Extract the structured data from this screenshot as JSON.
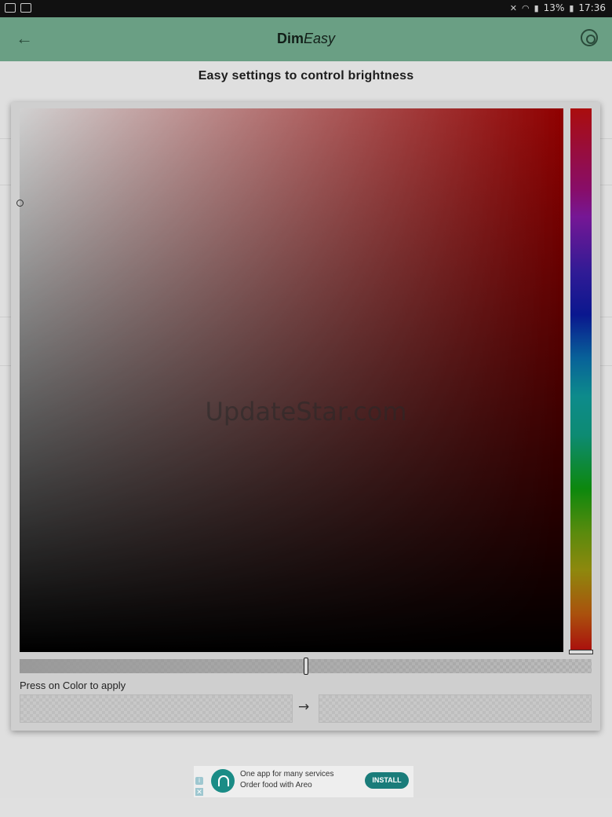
{
  "status_bar": {
    "battery": "13%",
    "time": "17:36",
    "icons": [
      "image-icon",
      "screen-icon",
      "mute-icon",
      "wifi-icon",
      "signal-icon",
      "battery-icon"
    ]
  },
  "app_bar": {
    "title_bold": "Dim",
    "title_italic": "Easy",
    "back_icon": "arrow-back-icon",
    "settings_icon": "refresh-settings-icon"
  },
  "subtitle": "Easy settings to control brightness",
  "color_picker": {
    "hue_color": "#b00000",
    "apply_label": "Press on Color to apply",
    "arrow": "→",
    "alpha_level": 0.5
  },
  "watermark": "UpdateStar.com",
  "ad": {
    "line1": "One app for many services",
    "line2": "Order food with Areo",
    "install_label": "INSTALL",
    "info_glyph": "i",
    "close_glyph": "✕"
  }
}
